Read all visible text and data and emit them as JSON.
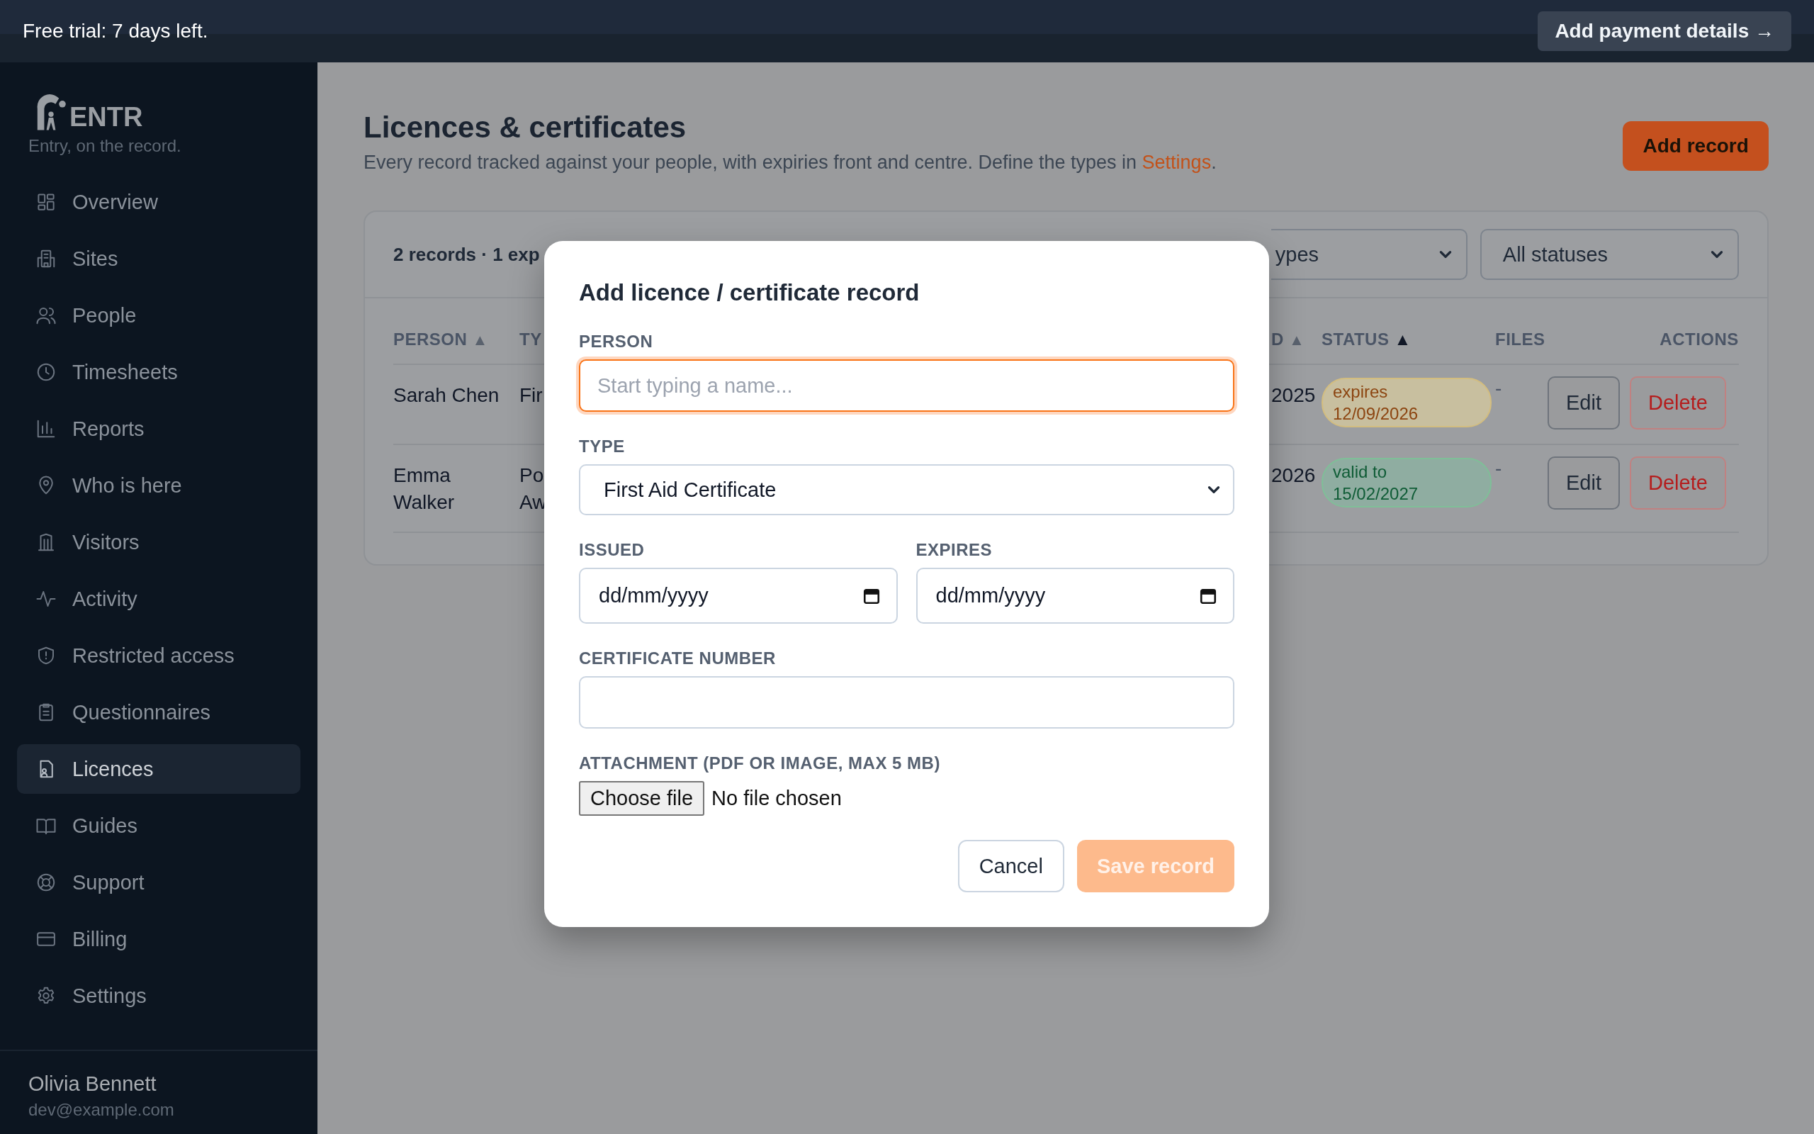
{
  "trial_banner": {
    "text": "Free trial: 7 days left.",
    "button": "Add payment details →"
  },
  "sidebar": {
    "logo_text": "ENTR",
    "tagline": "Entry, on the record.",
    "items": [
      {
        "label": "Overview",
        "selected": false
      },
      {
        "label": "Sites",
        "selected": false
      },
      {
        "label": "People",
        "selected": false
      },
      {
        "label": "Timesheets",
        "selected": false
      },
      {
        "label": "Reports",
        "selected": false
      },
      {
        "label": "Who is here",
        "selected": false
      },
      {
        "label": "Visitors",
        "selected": false
      },
      {
        "label": "Activity",
        "selected": false
      },
      {
        "label": "Restricted access",
        "selected": false
      },
      {
        "label": "Questionnaires",
        "selected": false
      },
      {
        "label": "Licences",
        "selected": true
      },
      {
        "label": "Guides",
        "selected": false
      },
      {
        "label": "Support",
        "selected": false
      },
      {
        "label": "Billing",
        "selected": false
      },
      {
        "label": "Settings",
        "selected": false
      }
    ],
    "user": {
      "name": "Olivia Bennett",
      "email": "dev@example.com"
    }
  },
  "page": {
    "title": "Licences & certificates",
    "subtitle": "Every record tracked against your people, with expiries front and centre. Define the types in ",
    "subtitle_link": "Settings",
    "subtitle_end": ".",
    "add_button": "Add record"
  },
  "records": {
    "summary": "2 records · 1 exp",
    "filters": [
      {
        "value": "ypes"
      },
      {
        "value": "All statuses"
      }
    ],
    "columns": [
      {
        "label": "PERSON",
        "sort": "▲",
        "sort_active": false
      },
      {
        "label": "TY"
      },
      {
        "label": "D",
        "sort": "▲",
        "sort_active": false
      },
      {
        "label": "STATUS",
        "sort": "▲",
        "sort_active": true
      },
      {
        "label": "FILES"
      },
      {
        "label": "ACTIONS"
      }
    ],
    "rows": [
      {
        "person": "Sarah Chen",
        "type": "Fir",
        "column_3": "2025",
        "status": {
          "kind": "expiring",
          "label": "expires",
          "date": "12/09/2026"
        },
        "files": "-",
        "actions": [
          "Edit",
          "Delete"
        ]
      },
      {
        "person": "Emma Walker",
        "type": "Po Aw",
        "column_3": "2026",
        "status": {
          "kind": "valid",
          "label": "valid to",
          "date": "15/02/2027"
        },
        "files": "-",
        "actions": [
          "Edit",
          "Delete"
        ]
      }
    ]
  },
  "modal": {
    "title": "Add licence / certificate record",
    "fields": [
      {
        "kind": "text",
        "label": "PERSON",
        "placeholder": "Start typing a name...",
        "focused": true
      },
      {
        "kind": "select",
        "label": "TYPE",
        "value": "First Aid Certificate"
      },
      {
        "kind": "dates",
        "fields": [
          {
            "label": "ISSUED",
            "value": "dd/mm/yyyy"
          },
          {
            "label": "EXPIRES",
            "value": "dd/mm/yyyy"
          }
        ]
      },
      {
        "kind": "text",
        "label": "CERTIFICATE NUMBER",
        "focused": false
      },
      {
        "kind": "file",
        "label": "ATTACHMENT (PDF OR IMAGE, MAX 5 MB)",
        "button": "Choose file",
        "status": "No file chosen"
      }
    ],
    "buttons": [
      {
        "label": "Cancel",
        "kind": "secondary",
        "disabled": false
      },
      {
        "label": "Save record",
        "kind": "primary",
        "disabled": true
      }
    ]
  }
}
